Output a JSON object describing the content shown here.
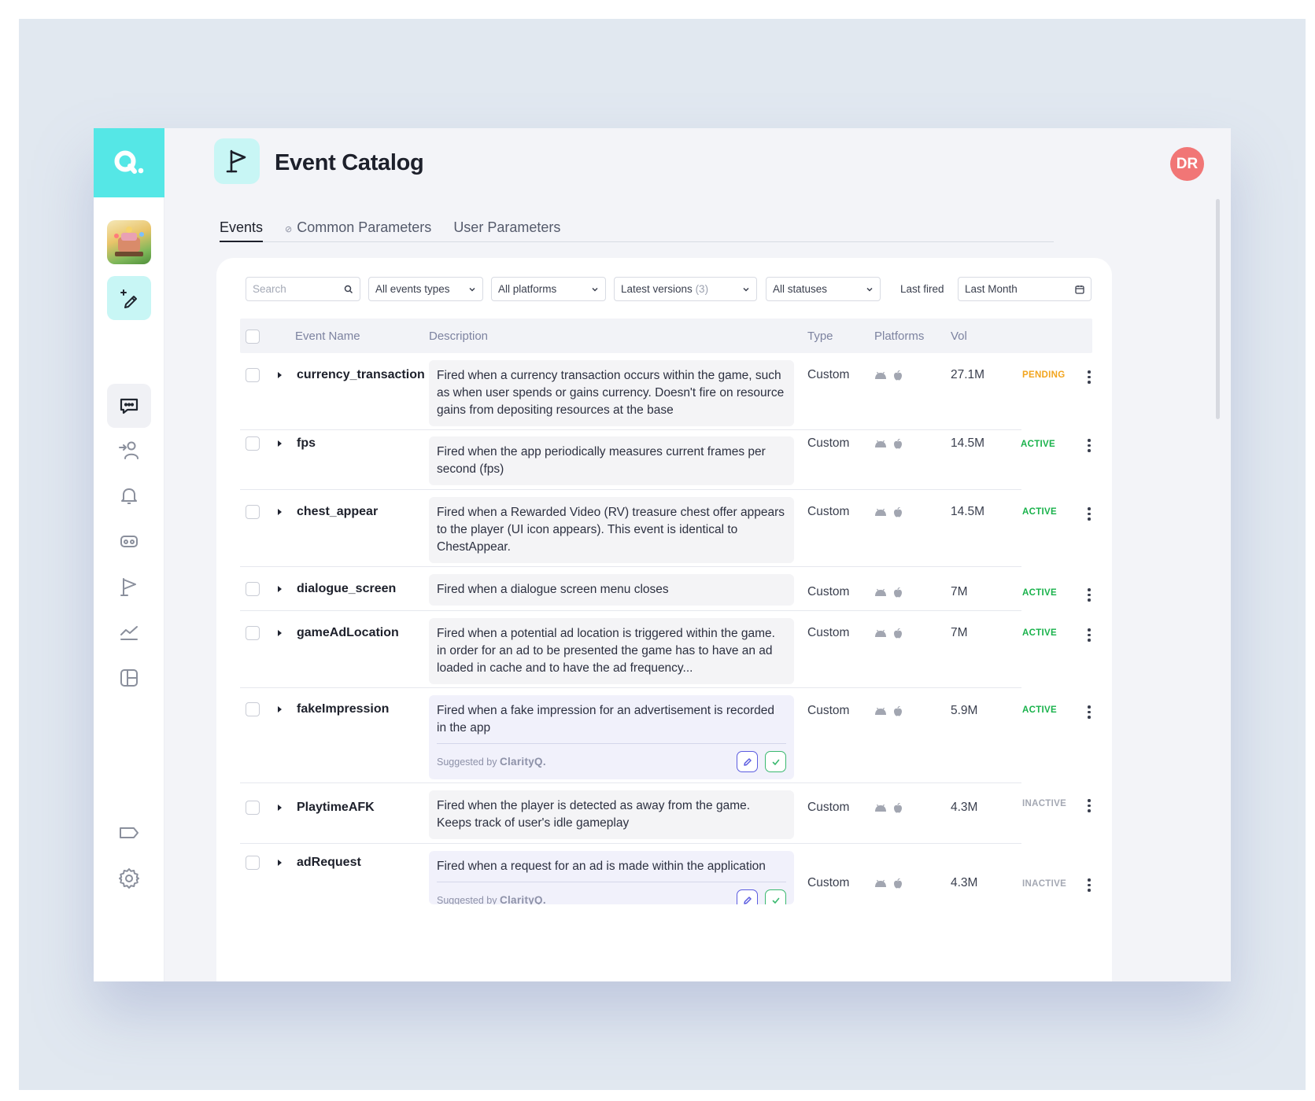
{
  "header": {
    "title": "Event Catalog",
    "avatar_initials": "DR"
  },
  "tabs": [
    {
      "label": "Events",
      "active": true
    },
    {
      "label": "Common Parameters",
      "active": false
    },
    {
      "label": "User Parameters",
      "active": false
    }
  ],
  "filters": {
    "search_placeholder": "Search",
    "event_types": "All events types",
    "platforms": "All platforms",
    "versions": "Latest versions",
    "versions_count": "(3)",
    "statuses": "All statuses",
    "last_fired_label": "Last fired",
    "last_fired_value": "Last Month"
  },
  "table": {
    "columns": {
      "name": "Event Name",
      "description": "Description",
      "type": "Type",
      "platforms": "Platforms",
      "volume": "Vol"
    },
    "suggested_by": "Suggested by",
    "brand": "ClarityQ.",
    "rows": [
      {
        "name": "currency_transaction",
        "description": "Fired when a currency transaction occurs within the game, such as when user spends or gains currency. Doesn't fire on resource gains from depositing resources at the base",
        "type": "Custom",
        "volume": "27.1M",
        "status": "PENDING"
      },
      {
        "name": "fps",
        "description": "Fired when the app periodically measures current frames per second (fps)",
        "type": "Custom",
        "volume": "14.5M",
        "status": "ACTIVE"
      },
      {
        "name": "chest_appear",
        "description": "Fired when a Rewarded Video (RV) treasure chest offer appears to the player (UI icon appears). This event is identical to ChestAppear.",
        "type": "Custom",
        "volume": "14.5M",
        "status": "ACTIVE"
      },
      {
        "name": "dialogue_screen",
        "description": "Fired when a dialogue screen menu closes",
        "type": "Custom",
        "volume": "7M",
        "status": "ACTIVE"
      },
      {
        "name": "gameAdLocation",
        "description": "Fired when a potential ad location is triggered within the game. in order for an ad to be presented the game has to have an ad loaded in cache and to have the ad frequency...",
        "type": "Custom",
        "volume": "7M",
        "status": "ACTIVE"
      },
      {
        "name": "fakeImpression",
        "description": "Fired when a fake impression for an advertisement is recorded in the app",
        "type": "Custom",
        "volume": "5.9M",
        "status": "ACTIVE"
      },
      {
        "name": "PlaytimeAFK",
        "description": "Fired when the player is detected as away from the game. Keeps track of user's idle gameplay",
        "type": "Custom",
        "volume": "4.3M",
        "status": "INACTIVE"
      },
      {
        "name": "adRequest",
        "description": "Fired when a request for an ad is made within the application",
        "type": "Custom",
        "volume": "4.3M",
        "status": "INACTIVE"
      }
    ]
  }
}
